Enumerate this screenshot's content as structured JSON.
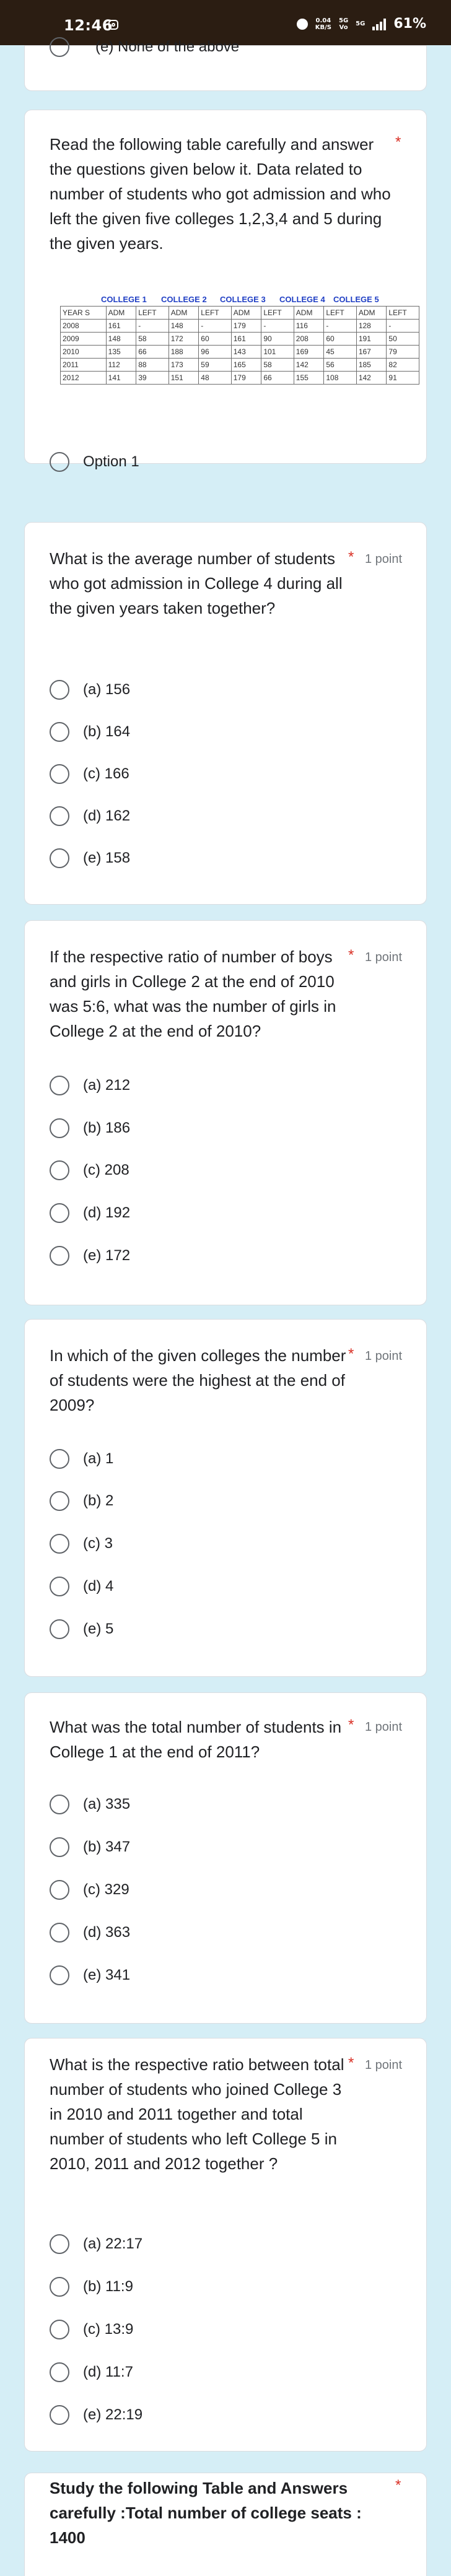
{
  "status": {
    "time": "12:46",
    "network_speed_top": "0.04",
    "network_speed_unit": "KB/S",
    "net_type_top": "5G",
    "net_type_bottom": "Vo",
    "network_type2_top": "5G",
    "battery": "61%"
  },
  "top_partial_option": "(e) None of the above",
  "table_question": {
    "text": "Read the following table carefully and answer the questions given below it. Data related to number of students who got admission and who left the given five colleges 1,2,3,4 and 5 during the given years.",
    "college_heads": [
      "COLLEGE 1",
      "COLLEGE 2",
      "COLLEGE 3",
      "COLLEGE 4",
      "COLLEGE 5"
    ],
    "columns": [
      "YEAR S",
      "ADM",
      "LEFT",
      "ADM",
      "LEFT",
      "ADM",
      "LEFT",
      "ADM",
      "LEFT",
      "ADM",
      "LEFT"
    ],
    "rows": [
      [
        "2008",
        "161",
        "-",
        "148",
        "-",
        "179",
        "-",
        "116",
        "-",
        "128",
        "-"
      ],
      [
        "2009",
        "148",
        "58",
        "172",
        "60",
        "161",
        "90",
        "208",
        "60",
        "191",
        "50"
      ],
      [
        "2010",
        "135",
        "66",
        "188",
        "96",
        "143",
        "101",
        "169",
        "45",
        "167",
        "79"
      ],
      [
        "2011",
        "112",
        "88",
        "173",
        "59",
        "165",
        "58",
        "142",
        "56",
        "185",
        "82"
      ],
      [
        "2012",
        "141",
        "39",
        "151",
        "48",
        "179",
        "66",
        "155",
        "108",
        "142",
        "91"
      ]
    ],
    "option": "Option 1"
  },
  "questions": [
    {
      "text": "What is the average number of students who got admission in College 4 during all the given years taken together?",
      "points": "1 point",
      "options": [
        "(a) 156",
        "(b) 164",
        "(c) 166",
        "(d) 162",
        "(e) 158"
      ]
    },
    {
      "text": "If the respective ratio of number of boys and girls in College 2 at the end of 2010 was 5:6, what was the number of girls in College 2 at the end of 2010?",
      "points": "1 point",
      "options": [
        "(a) 212",
        "(b) 186",
        "(c) 208",
        "(d) 192",
        "(e) 172"
      ]
    },
    {
      "text": "In which of the given colleges the number of students were the highest at the end of 2009?",
      "points": "1 point",
      "options": [
        "(a) 1",
        "(b) 2",
        "(c) 3",
        "(d) 4",
        "(e) 5"
      ]
    },
    {
      "text": "What was the total number of students in College 1 at the end of 2011?",
      "points": "1 point",
      "options": [
        "(a) 335",
        "(b) 347",
        "(c) 329",
        "(d) 363",
        "(e) 341"
      ]
    },
    {
      "text": "What is the respective ratio between total number of students who joined College 3 in 2010 and 2011 together and total number of students who left College 5 in 2010, 2011 and 2012 together ?",
      "points": "1 point",
      "options": [
        "(a) 22:17",
        "(b) 11:9",
        "(c) 13:9",
        "(d) 11:7",
        "(e) 22:19"
      ]
    }
  ],
  "last_question": {
    "text": "Study the following Table and Answers carefully :Total number of  college seats  :  1400"
  },
  "required_mark": "*"
}
